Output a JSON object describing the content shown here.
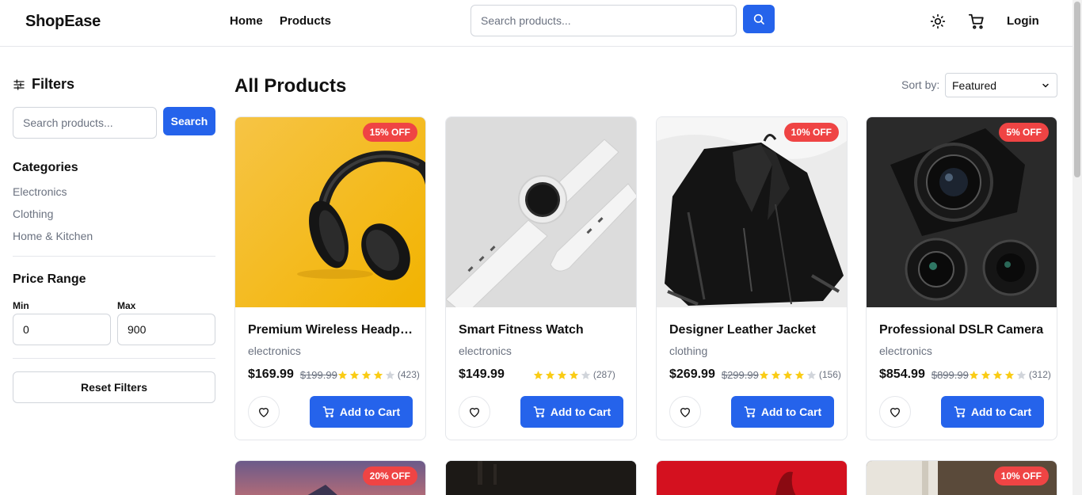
{
  "header": {
    "logo": "ShopEase",
    "nav": [
      "Home",
      "Products"
    ],
    "search_placeholder": "Search products...",
    "login": "Login",
    "icons": [
      "search-icon",
      "sun-icon",
      "cart-icon"
    ]
  },
  "sidebar": {
    "title": "Filters",
    "search_placeholder": "Search products...",
    "search_button": "Search",
    "categories_title": "Categories",
    "categories": [
      "Electronics",
      "Clothing",
      "Home & Kitchen"
    ],
    "price_title": "Price Range",
    "min_label": "Min",
    "max_label": "Max",
    "min_value": "0",
    "max_value": "900",
    "reset_button": "Reset Filters"
  },
  "main": {
    "title": "All Products",
    "sort_label": "Sort by:",
    "sort_value": "Featured"
  },
  "colors": {
    "accent": "#2563eb",
    "badge": "#ef4444",
    "star": "#facc15"
  },
  "products": [
    {
      "name": "Premium Wireless Headph...",
      "category": "electronics",
      "price": "$169.99",
      "old_price": "$199.99",
      "rating": 4,
      "reviews": "(423)",
      "badge": "15% OFF",
      "add_label": "Add to Cart"
    },
    {
      "name": "Smart Fitness Watch",
      "category": "electronics",
      "price": "$149.99",
      "old_price": "",
      "rating": 4,
      "reviews": "(287)",
      "badge": "",
      "add_label": "Add to Cart"
    },
    {
      "name": "Designer Leather Jacket",
      "category": "clothing",
      "price": "$269.99",
      "old_price": "$299.99",
      "rating": 4,
      "reviews": "(156)",
      "badge": "10% OFF",
      "add_label": "Add to Cart"
    },
    {
      "name": "Professional DSLR Camera",
      "category": "electronics",
      "price": "$854.99",
      "old_price": "$899.99",
      "rating": 4,
      "reviews": "(312)",
      "badge": "5% OFF",
      "add_label": "Add to Cart"
    }
  ],
  "products_row2": [
    {
      "badge": "20% OFF"
    },
    {
      "badge": ""
    },
    {
      "badge": ""
    },
    {
      "badge": "10% OFF"
    }
  ]
}
